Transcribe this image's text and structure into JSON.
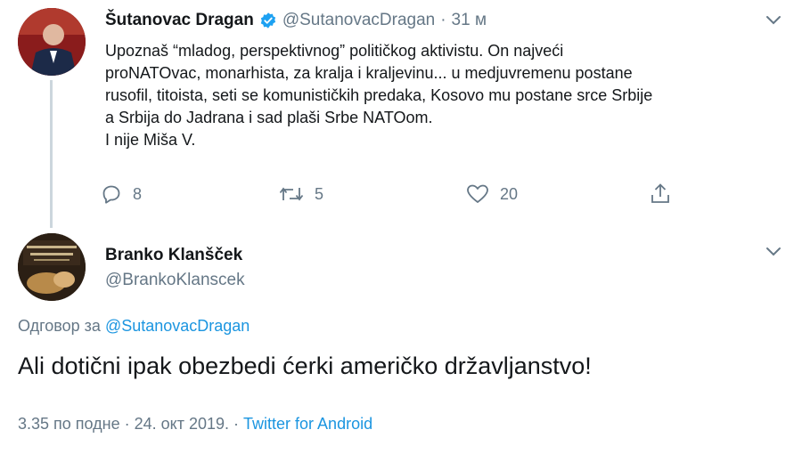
{
  "original_tweet": {
    "author_name": "Šutanovac Dragan",
    "author_handle": "@SutanovacDragan",
    "separator": "·",
    "time": "31 м",
    "text_lines": [
      "Upoznaš “mladog, perspektivnog” političkog aktivistu. On najveći",
      "proNATOvac, monarhista, za kralja i kraljevinu... u medjuvremenu postane",
      "rusofil, titoista, seti se komunističkih predaka, Kosovo mu postane srce Srbije",
      "a Srbija do Jadrana i sad plaši Srbe NATOom.",
      "I nije Miša V."
    ],
    "replies": "8",
    "retweets": "5",
    "likes": "20"
  },
  "reply_tweet": {
    "author_name": "Branko Klanšček",
    "author_handle": "@BrankoKlanscek",
    "reply_to_prefix": "Одговор за",
    "reply_to_handle": "@SutanovacDragan",
    "text": "Ali dotični ipak obezbedi ćerki američko državljanstvo!",
    "timestamp": "3.35 по подне · 24. окт 2019. ·",
    "source": "Twitter for Android"
  },
  "colors": {
    "verified": "#1da1f2",
    "link": "#1b95e0",
    "secondary_text": "#657786"
  }
}
